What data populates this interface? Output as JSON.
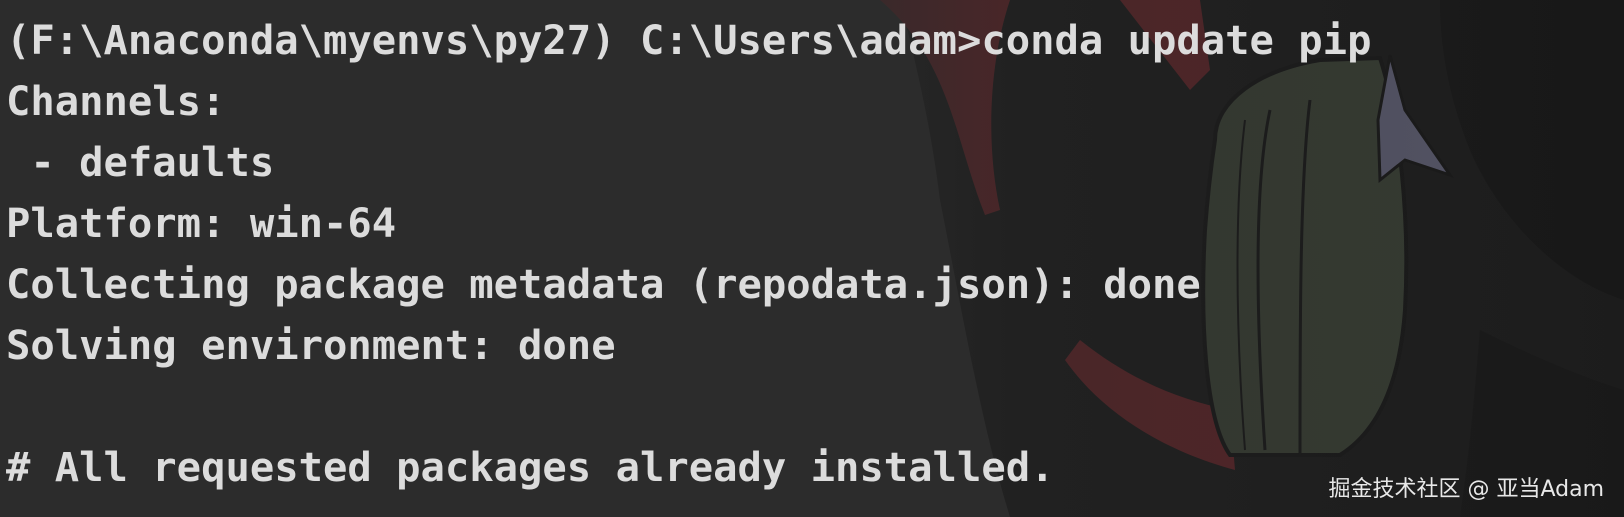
{
  "terminal": {
    "lines": [
      "(F:\\Anaconda\\myenvs\\py27) C:\\Users\\adam>conda update pip",
      "Channels:",
      " - defaults",
      "Platform: win-64",
      "Collecting package metadata (repodata.json): done",
      "Solving environment: done",
      "",
      "# All requested packages already installed."
    ]
  },
  "watermark": {
    "text": "掘金技术社区 @ 亚当Adam"
  },
  "colors": {
    "background": "#2c2c2c",
    "text": "#dcdcdc",
    "art_red": "#6b1f24",
    "art_green": "#3a4334",
    "art_black": "#111111"
  }
}
